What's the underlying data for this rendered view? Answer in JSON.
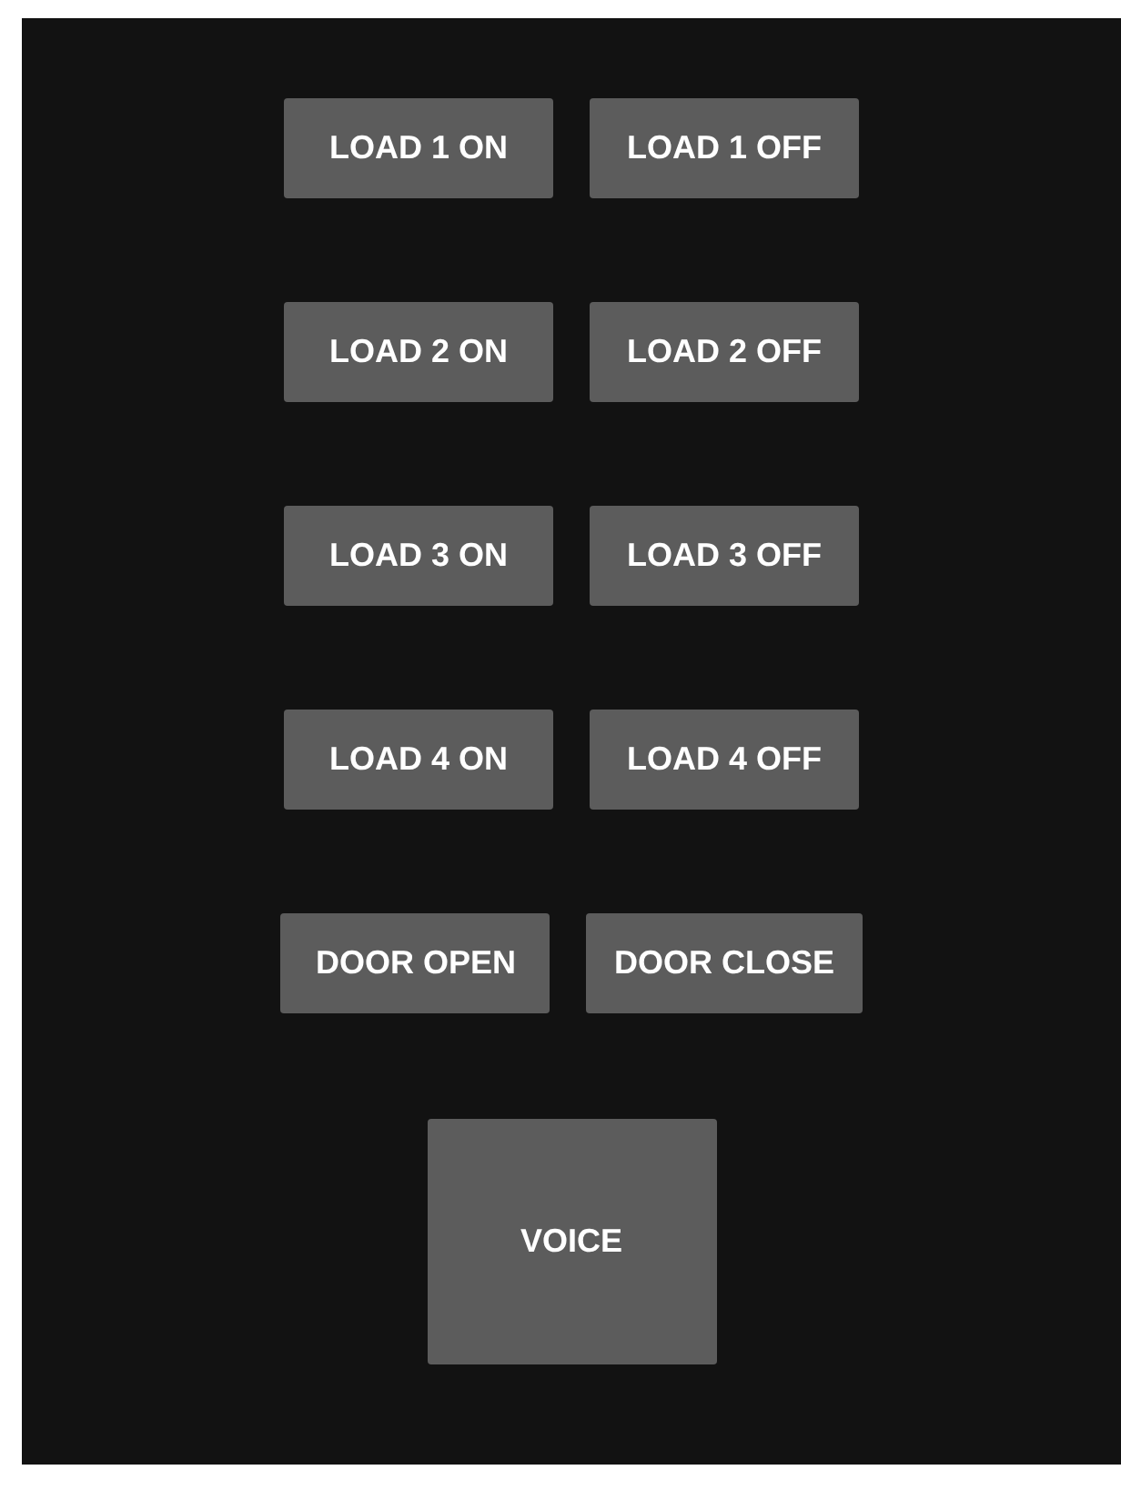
{
  "button_rows": [
    {
      "buttons": [
        "LOAD 1 ON",
        "LOAD 1 OFF"
      ]
    },
    {
      "buttons": [
        "LOAD 2 ON",
        "LOAD 2 OFF"
      ]
    },
    {
      "buttons": [
        "LOAD 3 ON",
        "LOAD 3 OFF"
      ]
    },
    {
      "buttons": [
        "LOAD 4 ON",
        "LOAD 4 OFF"
      ]
    },
    {
      "buttons": [
        "DOOR OPEN",
        "DOOR CLOSE"
      ]
    }
  ],
  "voice_button": {
    "label": "VOICE"
  }
}
